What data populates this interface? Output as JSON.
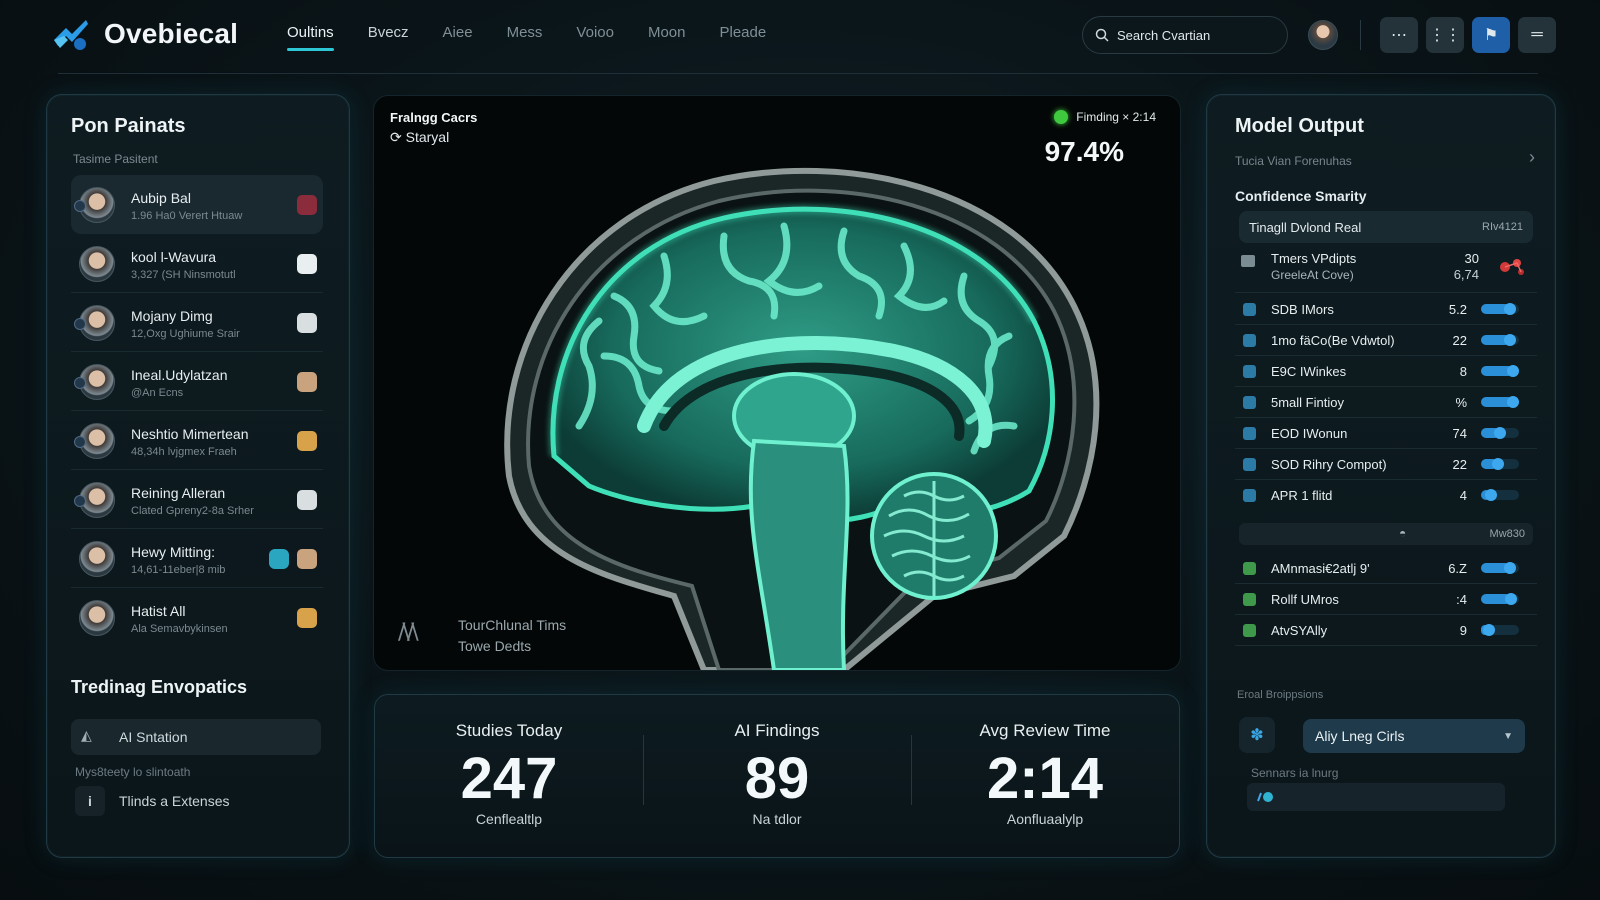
{
  "app": {
    "name": "Ovebiecal",
    "accent": "#2ec7d6",
    "nav_tabs": [
      {
        "label": "Oultins",
        "active": true
      },
      {
        "label": "Bvecz",
        "active": false
      },
      {
        "label": "Aiee",
        "active": false
      },
      {
        "label": "Mess",
        "active": false
      },
      {
        "label": "Voioo",
        "active": false
      },
      {
        "label": "Moon",
        "active": false
      },
      {
        "label": "Pleade",
        "active": false
      }
    ],
    "search_placeholder": "Search Cvartian",
    "toolbar_icons": [
      "more-icon",
      "grid-icon",
      "flag-icon",
      "menu-icon"
    ]
  },
  "patients_panel": {
    "title": "Pon Painats",
    "subtitle": "Tasime Pasitent",
    "patients": [
      {
        "name": "Aubip Bal",
        "detail": "1.96 Ha0 Verert Htuaw",
        "selected": true
      },
      {
        "name": "kool l-Wavura",
        "detail": "3,327 (SH Ninsmotutl"
      },
      {
        "name": "Mojany Dimg",
        "detail": "12,Oxg Ughiume Srair"
      },
      {
        "name": "Ineal.Udylatzan",
        "detail": "@An Ecns"
      },
      {
        "name": "Neshtio Mimertean",
        "detail": "48,34h lvjgmex Fraeh"
      },
      {
        "name": "Reining Alleran",
        "detail": "Clated Gpreny2-8a Srher"
      },
      {
        "name": "Hewy Mitting:",
        "detail": "14,61-11eber|8 mib"
      },
      {
        "name": "Hatist All",
        "detail": "Ala Semavbykinsen"
      }
    ],
    "trending_title": "Tredinag Envopatics",
    "ai_station": "AI Sntation",
    "mystery_text": "Mys8teety lo slintoath",
    "extension_label": "Tlinds a Extenses"
  },
  "viewer": {
    "title": "Fralngg Cacrs",
    "status": "Staryal",
    "finding_label": "Fimding × 2:14",
    "finding_color": "#3fc93f",
    "confidence": "97.4%",
    "footer_line1": "TourChlunal Tims",
    "footer_line2": "Towe Dedts",
    "overlay_color": "#3fe0b8"
  },
  "stats": [
    {
      "label": "Studies Today",
      "value": "247",
      "sub": "Cenflealtlp"
    },
    {
      "label": "AI Findings",
      "value": "89",
      "sub": "Na tdlor"
    },
    {
      "label": "Avg Review Time",
      "value": "2:14",
      "sub": "Aonfluaalylp"
    }
  ],
  "model_output": {
    "title": "Model Output",
    "subtitle": "Tucia Vian Forenuhas",
    "section": "Confidence Smarity",
    "header_row": {
      "label": "Tinagll Dvlond Real",
      "value": "RIv4121"
    },
    "first_row": {
      "label": "Tmers VPdipts",
      "sub": "GreeleAt Cove)",
      "value1": "30",
      "value2": "6,74"
    },
    "rows": [
      {
        "label": "SDB IMors",
        "value": "5.2",
        "level": 0.75
      },
      {
        "label": "1mo fäCo(Be Vdwtol)",
        "value": "22",
        "level": 0.75
      },
      {
        "label": "E9C IWinkes",
        "value": "8",
        "level": 0.85
      },
      {
        "label": "5mall Fintioy",
        "value": "%",
        "level": 0.9
      },
      {
        "label": "EOD IWonun",
        "value": "74",
        "level": 0.5
      },
      {
        "label": "SOD Rihry Compot)",
        "value": "22",
        "level": 0.45
      },
      {
        "label": "APR 1 flitd",
        "value": "4",
        "level": 0.25
      }
    ],
    "divider_value": "Mw830",
    "rows2": [
      {
        "label": "AMnmasi€2atlj 9'",
        "value": "6.Z",
        "level": 0.75
      },
      {
        "label": "Rollf UMros",
        "value": ":4",
        "level": 0.8
      },
      {
        "label": "AtvSYAlly",
        "value": "9",
        "level": 0.2
      }
    ],
    "eval_label": "Eroal Broippsions",
    "select_value": "Aliy Lneg Cirls",
    "sensors_label": "Sennars ia lnurg"
  }
}
